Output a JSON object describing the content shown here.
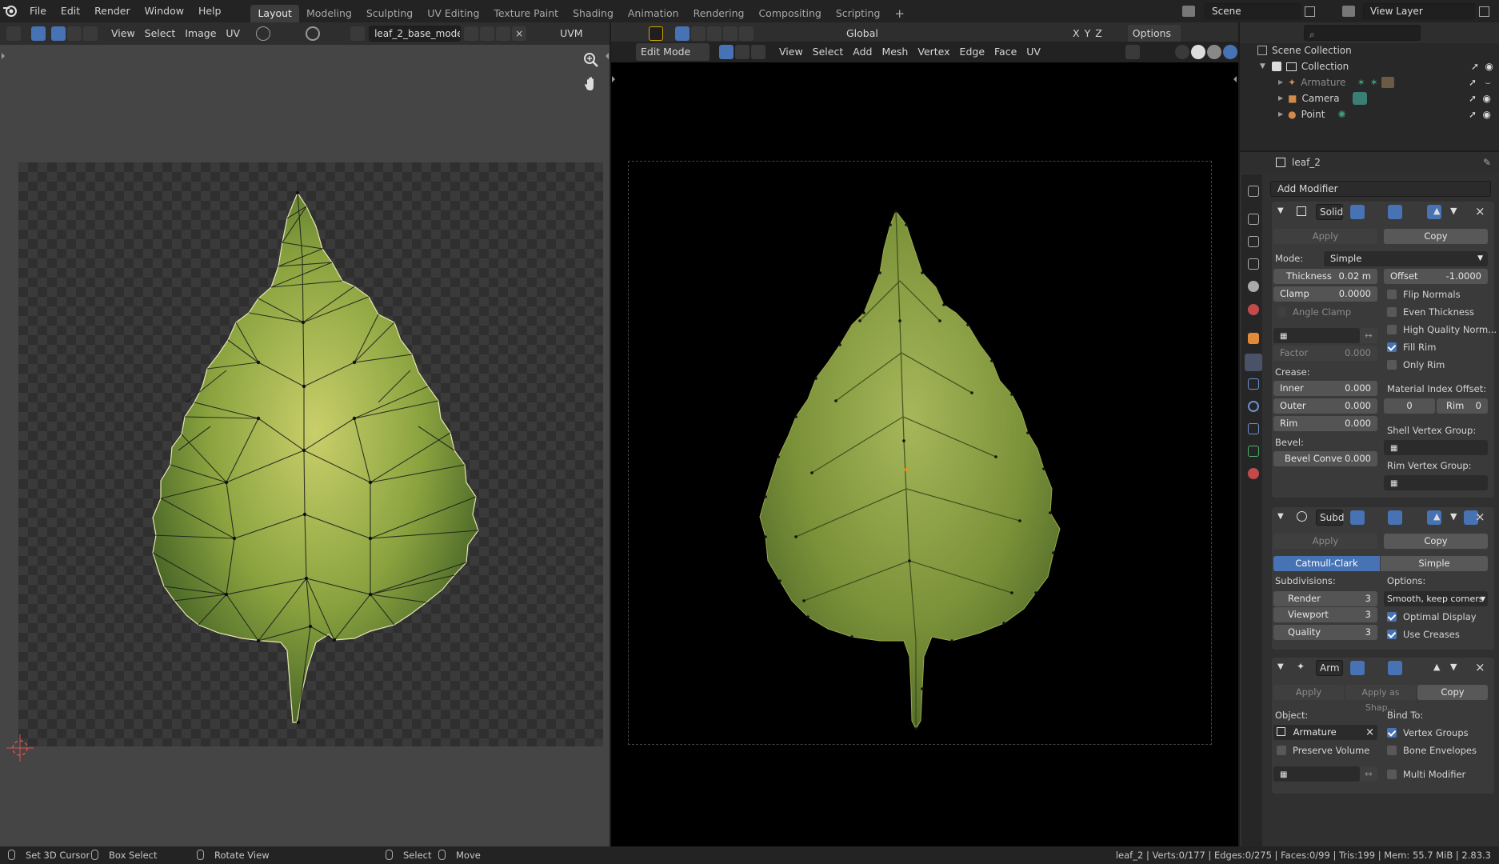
{
  "topbar": {
    "menus": [
      "File",
      "Edit",
      "Render",
      "Window",
      "Help"
    ],
    "workspaces": [
      "Layout",
      "Modeling",
      "Sculpting",
      "UV Editing",
      "Texture Paint",
      "Shading",
      "Animation",
      "Rendering",
      "Compositing",
      "Scripting"
    ],
    "active_workspace": "Layout",
    "scene": "Scene",
    "view_layer": "View Layer"
  },
  "uv_editor": {
    "menus": [
      "View",
      "Select",
      "Image",
      "UV"
    ],
    "image_name": "leaf_2_base_model...",
    "uvmap_label": "UVM"
  },
  "viewport": {
    "mode": "Edit Mode",
    "menus": [
      "View",
      "Select",
      "Add",
      "Mesh",
      "Vertex",
      "Edge",
      "Face",
      "UV"
    ],
    "transform_orientation": "Global",
    "axes": [
      "X",
      "Y",
      "Z"
    ],
    "options_label": "Options"
  },
  "outliner": {
    "scene_collection": "Scene Collection",
    "collection": "Collection",
    "items": [
      "Armature",
      "Camera",
      "Point"
    ]
  },
  "properties": {
    "object_name": "leaf_2",
    "add_modifier": "Add Modifier",
    "apply": "Apply",
    "copy": "Copy",
    "apply_as_shape": "Apply as Shap...",
    "solidify": {
      "name": "Solid",
      "mode_label": "Mode:",
      "mode_value": "Simple",
      "thickness_label": "Thickness",
      "thickness_value": "0.02 m",
      "offset_label": "Offset",
      "offset_value": "-1.0000",
      "clamp_label": "Clamp",
      "clamp_value": "0.0000",
      "flip_normals": "Flip Normals",
      "angle_clamp": "Angle Clamp",
      "even_thickness": "Even Thickness",
      "high_quality_normals": "High Quality Norm...",
      "fill_rim": "Fill Rim",
      "factor_label": "Factor",
      "factor_value": "0.000",
      "only_rim": "Only Rim",
      "crease_label": "Crease:",
      "inner_label": "Inner",
      "inner_value": "0.000",
      "outer_label": "Outer",
      "outer_value": "0.000",
      "rim_label": "Rim",
      "rim_value": "0.000",
      "material_index_offset": "Material Index Offset:",
      "mat_offset_value": "0",
      "mat_rim_label": "Rim",
      "mat_rim_value": "0",
      "shell_vertex_group": "Shell Vertex Group:",
      "bevel_label": "Bevel:",
      "bevel_convex_label": "Bevel Conve",
      "bevel_convex_value": "0.000",
      "rim_vertex_group": "Rim Vertex Group:"
    },
    "subsurf": {
      "name": "Subd",
      "catmull": "Catmull-Clark",
      "simple": "Simple",
      "subdivisions_label": "Subdivisions:",
      "options_label": "Options:",
      "render_label": "Render",
      "render_value": "3",
      "viewport_label": "Viewport",
      "viewport_value": "3",
      "quality_label": "Quality",
      "quality_value": "3",
      "uv_smooth": "Smooth, keep corners",
      "optimal_display": "Optimal Display",
      "use_creases": "Use Creases"
    },
    "armature": {
      "name": "Arm",
      "object_label": "Object:",
      "object_value": "Armature",
      "bind_to": "Bind To:",
      "vertex_groups": "Vertex Groups",
      "preserve_volume": "Preserve Volume",
      "bone_envelopes": "Bone Envelopes",
      "multi_modifier": "Multi Modifier"
    }
  },
  "statusbar": {
    "set_cursor": "Set 3D Cursor",
    "box_select": "Box Select",
    "rotate_view": "Rotate View",
    "select": "Select",
    "move": "Move",
    "stats": "leaf_2 | Verts:0/177 | Edges:0/275 | Faces:0/99 | Tris:199 | Mem: 55.7 MiB | 2.83.3"
  },
  "colors": {
    "accent": "#4772b3",
    "leaf_green": "#7f9a3c",
    "leaf_yellow": "#c8c86a"
  }
}
